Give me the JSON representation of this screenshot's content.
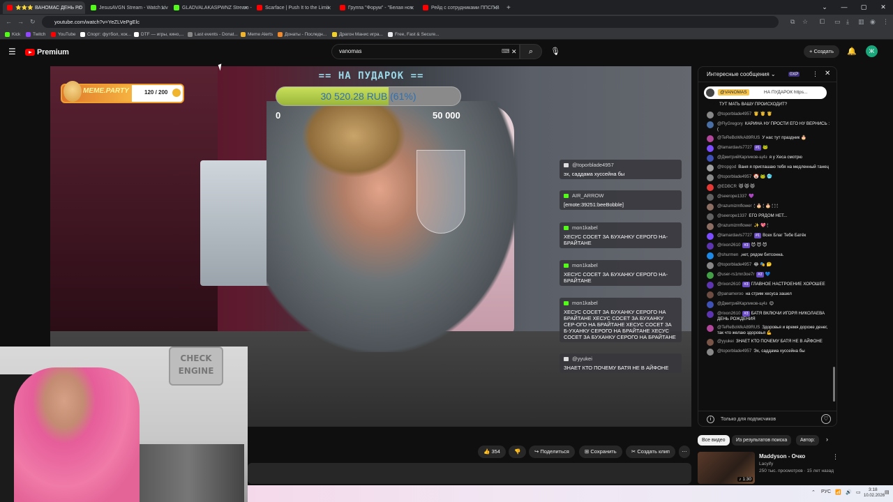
{
  "browser": {
    "tabs": [
      {
        "label": "⭐⭐⭐ ВАНОМАС ДЕНЬ РО",
        "color": "#ff0000",
        "active": true
      },
      {
        "label": "JesusAVGN Stream - Watch Liv",
        "color": "#53fc18"
      },
      {
        "label": "GLADVALAKASPWNZ Stream -",
        "color": "#53fc18"
      },
      {
        "label": "Scarface | Push It to the Limit",
        "color": "#ff0000"
      },
      {
        "label": "Группа \"Форум\" - \"Белая ноч",
        "color": "#ff0000"
      },
      {
        "label": "Рейд с сотрудниками ППСП В",
        "color": "#ff0000"
      }
    ],
    "url": "youtube.com/watch?v=YeZLVePgElc",
    "bookmarks": [
      {
        "label": "Kick",
        "color": "#53fc18"
      },
      {
        "label": "Twitch",
        "color": "#9146ff"
      },
      {
        "label": "YouTube",
        "color": "#ff0000"
      },
      {
        "label": "Спорт: футбол, хок...",
        "color": "#ffffff"
      },
      {
        "label": "DTF — игры, кино,...",
        "color": "#ffffff"
      },
      {
        "label": "Last events - Donat...",
        "color": "#888888"
      },
      {
        "label": "Meme Alerts",
        "color": "#f0b52c"
      },
      {
        "label": "Донаты - Последн...",
        "color": "#f08a2c"
      },
      {
        "label": "Драгон Манис игра...",
        "color": "#f0d02c"
      },
      {
        "label": "Free, Fast & Secure...",
        "color": "#e8eaed"
      }
    ]
  },
  "youtube": {
    "brand": "Premium",
    "search_value": "vanomas",
    "create_label": "Создать",
    "avatar_letter": "Ж"
  },
  "overlay": {
    "goal_title": "== НА ПУДАРОК ==",
    "goal_text": "30 520.28 RUB (61%)",
    "goal_fraction": 0.61,
    "goal_min": "0",
    "goal_max": "50 000",
    "meme_name": "MEME.PARTY",
    "meme_count": "120 / 200",
    "cam_sign": "CHECK ENGINE",
    "messages": [
      {
        "user": "@toporblade4957",
        "text": "эх, саддама хуссейна бы"
      },
      {
        "user": "AIR_ARROW",
        "text": "[emote:39251:beeBobble]"
      },
      {
        "user": "mon1kabel",
        "text": "ХЕСУС СОСЕТ ЗА БУХАНКУ СЕРОГО НА-БРАЙТАНЕ"
      },
      {
        "user": "mon1kabel",
        "text": "ХЕСУС СОСЕТ ЗА БУХАНКУ СЕРОГО НА-БРАЙТАНЕ"
      },
      {
        "user": "mon1kabel",
        "text": "ХЕСУС СОСЕТ ЗА БУХАНКУ СЕРОГО НА БРАЙТАНЕ ХЕСУС СОСЕТ ЗА БУХАНКУ СЕР-ОГО НА БРАЙТАНЕ ХЕСУС СОСЕТ ЗА Б-УХАНКУ СЕРОГО НА БРАЙТАНЕ ХЕСУС СОСЕТ ЗА БУХАНКУ СЕРОГО НА БРАЙТАНЕ"
      },
      {
        "user": "@yyukei",
        "text": "ЗНАЕТ КТО ПОЧЕМУ БАТЯ НЕ В АЙФОНЕ"
      }
    ]
  },
  "actions": {
    "likes": "354",
    "share": "Поделиться",
    "save": "Сохранить",
    "clip": "Создать клип"
  },
  "chat": {
    "title": "Интересные сообщения",
    "xp": "0XP",
    "pinned_name": "@VANOMAS",
    "pinned_text": "НА ПУДАРОК https...",
    "input_text": "Только для подписчиков",
    "messages": [
      {
        "name": "",
        "text": "ТУТ МАТЬ ВАШУ ПРОИСХОДИТ?",
        "color": "#0f0f0f"
      },
      {
        "name": "@toporblade4957",
        "text": "🤴 🤴 🤴",
        "color": "#888"
      },
      {
        "name": "@FlyGregory",
        "text": "КАРИНА НУ ПРОСТИ ЕГО НУ ВЕРНИСЬ :(",
        "color": "#4a6fa5"
      },
      {
        "name": "@TeReBoWkA89RUS",
        "text": "У нас тут праздник 🎂",
        "color": "#b0479a"
      },
      {
        "name": "@lamardavis7727",
        "badge": "#1",
        "text": "🐸",
        "color": "#7c4dff"
      },
      {
        "name": "@ДмитрийКарликов-щ4з",
        "text": "я у Хеса смотрю",
        "color": "#3f51b5"
      },
      {
        "name": "@tropgod",
        "text": "Ваня я приглашаю тебя на медленный танец",
        "color": "#9e9e9e"
      },
      {
        "name": "@toporblade4957",
        "text": "🤡 🐸 🥶",
        "color": "#888"
      },
      {
        "name": "@EDBCR",
        "text": "😾 😾 😾",
        "color": "#e53935"
      },
      {
        "name": "@seerope1337",
        "text": "💜",
        "color": "#616161"
      },
      {
        "name": "@razumizmflower",
        "text": "🕯 🎂 🕯 🎂 🕯 🕯 🕯",
        "color": "#8d6e63"
      },
      {
        "name": "@seerope1337",
        "text": "ЕГО РЯДОМ НЕТ...",
        "color": "#616161"
      },
      {
        "name": "@razumizmflower",
        "text": "✨ 💖 🕯",
        "color": "#8d6e63"
      },
      {
        "name": "@lamardavis7727",
        "badge": "#1",
        "text": "Всех Благ Тебе Батёк",
        "color": "#7c4dff"
      },
      {
        "name": "@rixon2610",
        "badge": "#3",
        "text": "😈 😈 😈",
        "color": "#5e35b1"
      },
      {
        "name": "@shurmen",
        "text": ",нет, рядом битсонна.",
        "color": "#1e88e5"
      },
      {
        "name": "@toporblade4957",
        "text": "😂 🎭 🤔",
        "color": "#888"
      },
      {
        "name": "@user-rs1mn3oe7r",
        "badge": "#2",
        "text": "💙",
        "color": "#43a047"
      },
      {
        "name": "@rixon2610",
        "badge": "#3",
        "text": "ГЛАВНОЕ НАСТРОЕНИЕ ХОРОШЕЕ",
        "color": "#5e35b1"
      },
      {
        "name": "@panameroo",
        "text": "на стрим хесуса зашел",
        "color": "#6d4c41"
      },
      {
        "name": "@ДмитрийКарликов-щ4з",
        "text": "😌",
        "color": "#3f51b5"
      },
      {
        "name": "@rixon2610",
        "badge": "#3",
        "text": "БАТЯ ВКЛЮЧИ ИГОРЯ НИКОЛАЕВА ДЕНЬ РОЖДЕНИЯ",
        "color": "#5e35b1"
      },
      {
        "name": "@TeReBoWkA89RUS",
        "text": "Здоровья и время дороже денег, так что желаю здоровья 💪",
        "color": "#b0479a"
      },
      {
        "name": "@yyukei",
        "text": "ЗНАЕТ КТО ПОЧЕМУ БАТЯ НЕ В АЙФОНЕ",
        "color": "#795548"
      },
      {
        "name": "@toporblade4957",
        "text": "Эх, саддама хуссейна бы",
        "color": "#888"
      }
    ]
  },
  "recommendations": {
    "chips": [
      "Все видео",
      "Из результатов поиска",
      "Автор: "
    ],
    "video": {
      "title": "Maddyson - Очко",
      "channel": "Lacyify",
      "meta": "250 тыс. просмотров · 15 лет назад",
      "duration": "1:30"
    }
  },
  "taskbar": {
    "lang": "РУС",
    "time": "3:18",
    "date": "10.02.2026"
  }
}
